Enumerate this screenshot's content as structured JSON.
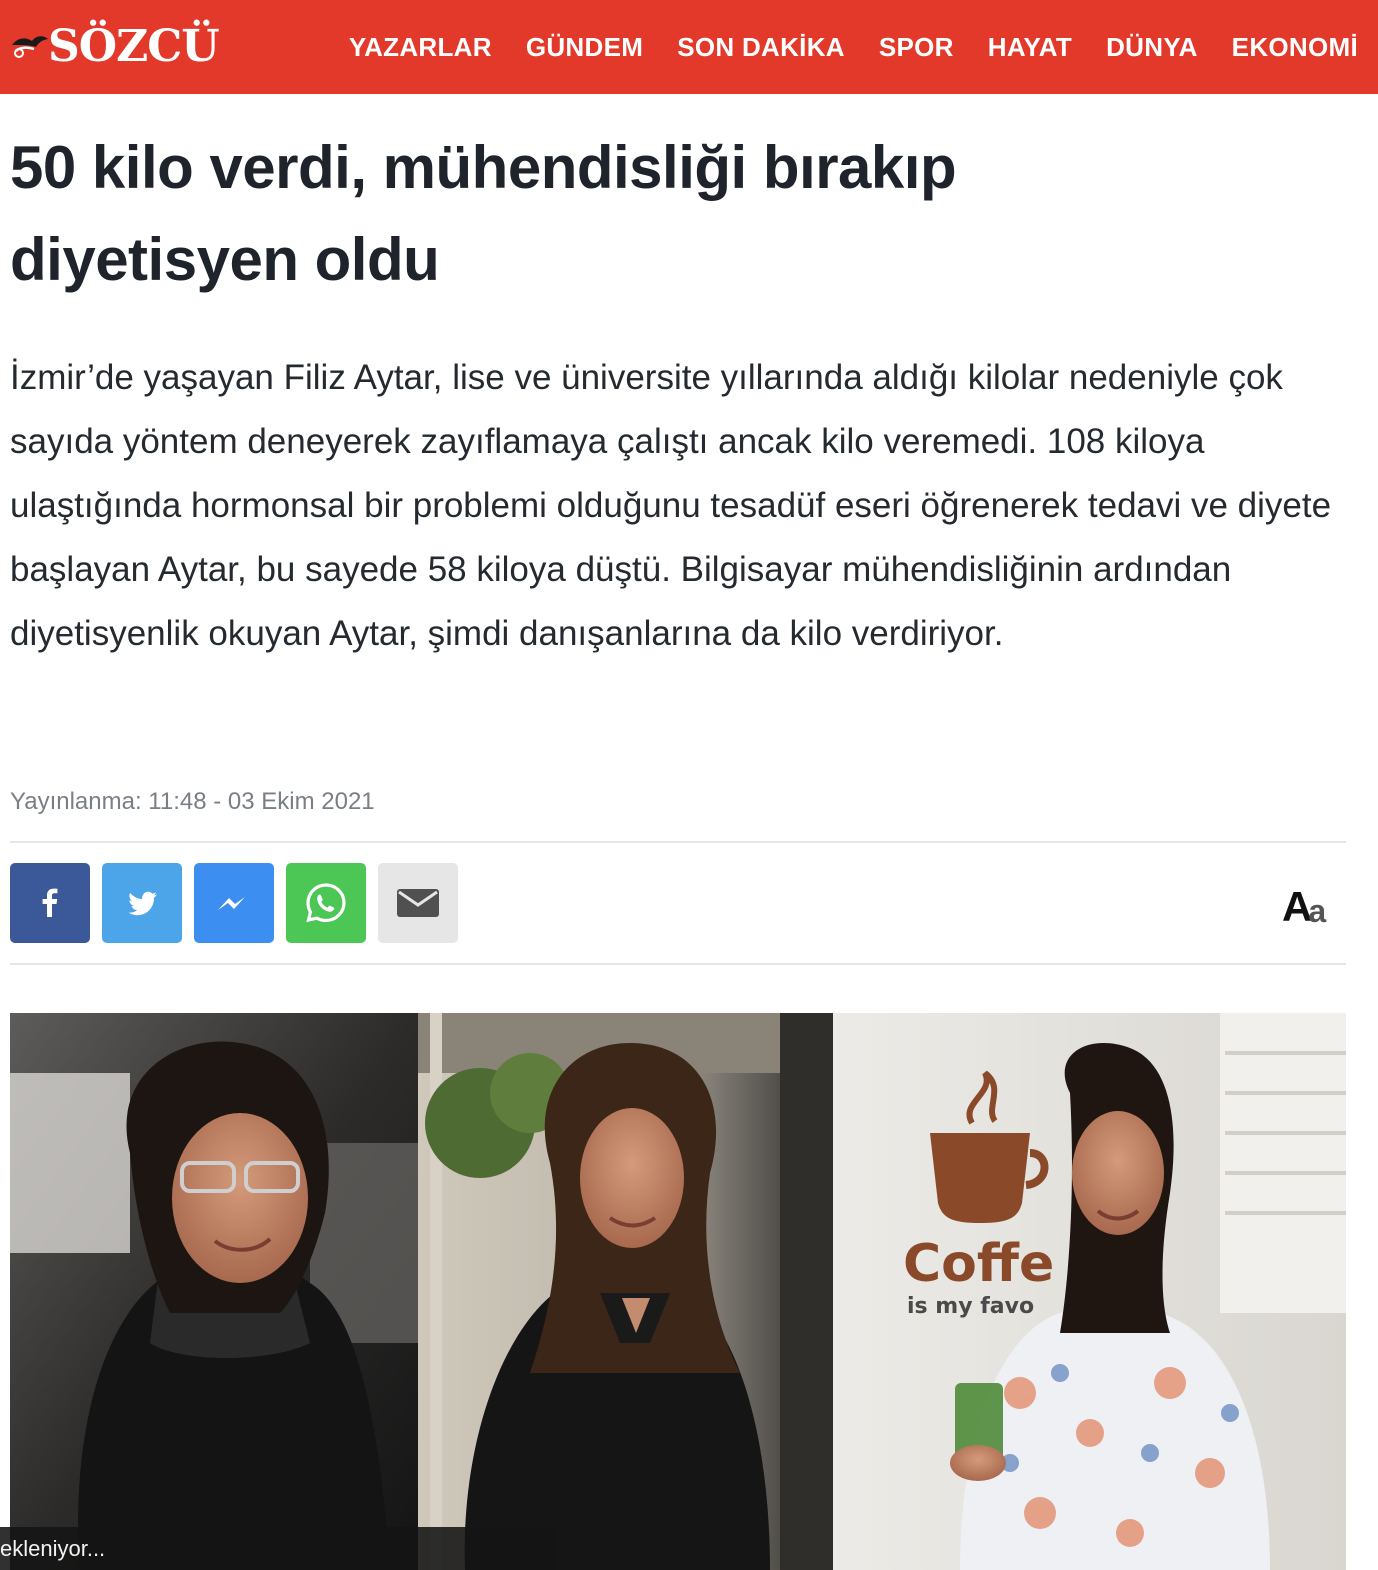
{
  "header": {
    "logo": "SÖZCÜ",
    "nav": [
      "YAZARLAR",
      "GÜNDEM",
      "SON DAKİKA",
      "SPOR",
      "HAYAT",
      "DÜNYA",
      "EKONOMİ"
    ]
  },
  "article": {
    "headline_line1": "50 kilo verdi, mühendisliği bırakıp",
    "headline_line2": "diyetisyen oldu",
    "lead": "İzmir’de yaşayan Filiz Aytar, lise ve üniversite yıllarında aldığı kilolar nedeniyle çok sayıda yöntem deneyerek zayıflamaya çalıştı ancak kilo veremedi. 108 kiloya ulaştığında hormonsal bir problemi olduğunu tesadüf eseri öğrenerek tedavi ve diyete başlayan Aytar, bu sayede 58 kiloya düştü. Bilgisayar mühendisliğinin ardından diyetisyenlik okuyan Aytar, şimdi danışanlarına da kilo verdiriyor.",
    "published": "Yayınlanma: 11:48 - 03 Ekim 2021"
  },
  "share": {
    "icons": [
      "facebook-icon",
      "twitter-icon",
      "messenger-icon",
      "whatsapp-icon",
      "email-icon"
    ]
  },
  "font_size": {
    "big": "A",
    "small": "a"
  },
  "photo": {
    "sign_text": "Coffe",
    "sign_sub": "is my favo"
  },
  "toast": {
    "text": "ekleniyor..."
  },
  "colors": {
    "brand_red": "#e2392b",
    "facebook": "#3b5998",
    "twitter": "#4ba5e8",
    "messenger": "#3c8ff0",
    "whatsapp": "#4cc655",
    "email": "#e6e6e6"
  }
}
